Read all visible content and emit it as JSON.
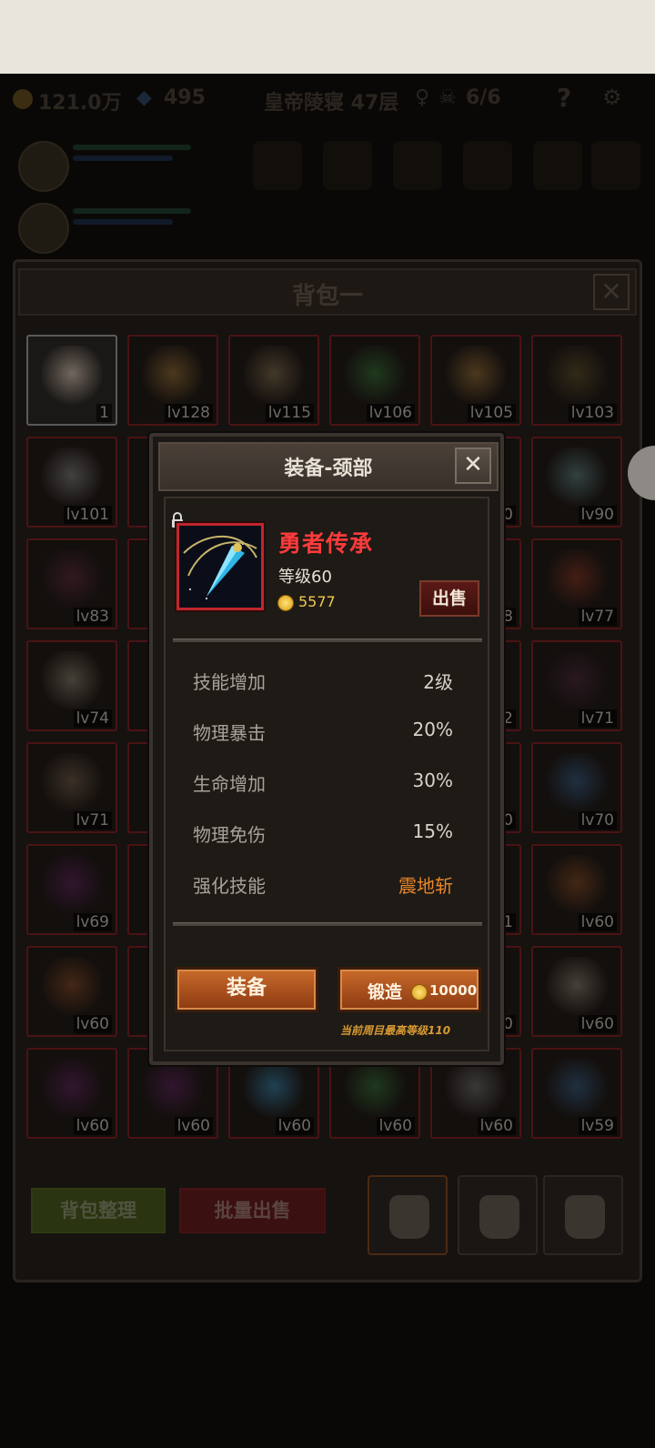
{
  "topbar": {
    "gold": "121.0万",
    "gems": "495",
    "location": "皇帝陵寝 47层",
    "party": "6/6",
    "help": "?"
  },
  "backpack": {
    "title": "背包一",
    "close": "✕",
    "items": [
      {
        "label": "1",
        "icon": "cake-icon"
      },
      {
        "label": "lv128",
        "icon": "bow-icon"
      },
      {
        "label": "lv115",
        "icon": "staff-icon"
      },
      {
        "label": "lv106",
        "icon": "armor-icon"
      },
      {
        "label": "lv105",
        "icon": "bow-icon"
      },
      {
        "label": "lv103",
        "icon": "ring-icon"
      },
      {
        "label": "lv101",
        "icon": "glove-icon"
      },
      {
        "label": "",
        "icon": "hidden"
      },
      {
        "label": "",
        "icon": "hidden"
      },
      {
        "label": "",
        "icon": "hidden"
      },
      {
        "label": "0",
        "icon": "hidden"
      },
      {
        "label": "lv90",
        "icon": "axe-icon"
      },
      {
        "label": "lv83",
        "icon": "boots-icon"
      },
      {
        "label": "",
        "icon": "hidden"
      },
      {
        "label": "",
        "icon": "hidden"
      },
      {
        "label": "",
        "icon": "hidden"
      },
      {
        "label": "8",
        "icon": "hidden"
      },
      {
        "label": "lv77",
        "icon": "dagger-icon"
      },
      {
        "label": "lv74",
        "icon": "sword-icon"
      },
      {
        "label": "",
        "icon": "hidden"
      },
      {
        "label": "",
        "icon": "hidden"
      },
      {
        "label": "",
        "icon": "hidden"
      },
      {
        "label": "2",
        "icon": "hidden"
      },
      {
        "label": "lv71",
        "icon": "cape-icon"
      },
      {
        "label": "lv71",
        "icon": "helmet-icon"
      },
      {
        "label": "",
        "icon": "hidden"
      },
      {
        "label": "",
        "icon": "hidden"
      },
      {
        "label": "",
        "icon": "hidden"
      },
      {
        "label": "0",
        "icon": "hidden"
      },
      {
        "label": "lv70",
        "icon": "shield-icon"
      },
      {
        "label": "lv69",
        "icon": "orb-icon"
      },
      {
        "label": "",
        "icon": "hidden"
      },
      {
        "label": "",
        "icon": "hidden"
      },
      {
        "label": "",
        "icon": "hidden"
      },
      {
        "label": "1",
        "icon": "hidden"
      },
      {
        "label": "lv60",
        "icon": "trident-icon"
      },
      {
        "label": "lv60",
        "icon": "trident-icon"
      },
      {
        "label": "",
        "icon": "hidden"
      },
      {
        "label": "",
        "icon": "hidden"
      },
      {
        "label": "",
        "icon": "hidden"
      },
      {
        "label": "0",
        "icon": "hidden"
      },
      {
        "label": "lv60",
        "icon": "sword-icon"
      },
      {
        "label": "lv60",
        "icon": "orb-icon"
      },
      {
        "label": "lv60",
        "icon": "orb-icon"
      },
      {
        "label": "lv60",
        "icon": "pendant-icon"
      },
      {
        "label": "lv60",
        "icon": "armor-icon"
      },
      {
        "label": "lv60",
        "icon": "chest-icon"
      },
      {
        "label": "lv59",
        "icon": "shield-icon"
      }
    ],
    "sort_label": "背包整理",
    "bulk_sell_label": "批量出售"
  },
  "dialog": {
    "title": "装备-颈部",
    "close": "✕",
    "item_name": "勇者传承",
    "item_level": "等级60",
    "item_price": "5577",
    "sell_label": "出售",
    "stats": [
      {
        "label": "技能增加",
        "value": "2级"
      },
      {
        "label": "物理暴击",
        "value": "20%"
      },
      {
        "label": "生命增加",
        "value": "30%"
      },
      {
        "label": "物理免伤",
        "value": "15%"
      },
      {
        "label": "强化技能",
        "value": "震地斩"
      }
    ],
    "equip_label": "装备",
    "forge_label": "锻造",
    "forge_cost": "10000",
    "max_level_note": "当前周目最高等级110"
  },
  "colors": {
    "item_name": "#ff3b3b",
    "skill": "#e8862a",
    "gold": "#f1c94c",
    "button_orange": "#c86a2a"
  }
}
